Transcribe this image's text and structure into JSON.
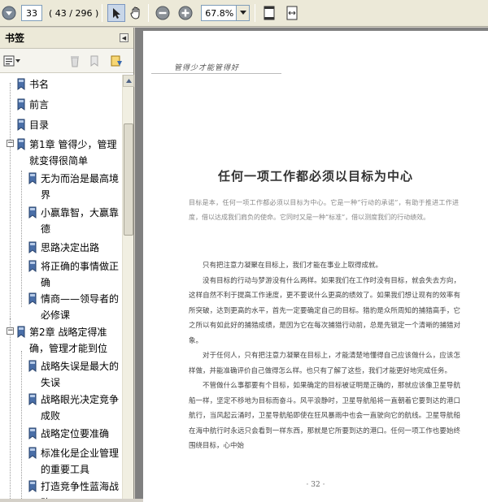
{
  "toolbar": {
    "page_current": "33",
    "page_count": "( 43 / 296 )",
    "zoom": "67.8%"
  },
  "sidebar": {
    "title": "书签",
    "items": [
      {
        "label": "书名",
        "level": 0
      },
      {
        "label": "前言",
        "level": 0
      },
      {
        "label": "目录",
        "level": 0
      },
      {
        "label": "第1章 管得少，管理就变得很简单",
        "level": 0,
        "expander": "−"
      },
      {
        "label": "无为而治是最高境界",
        "level": 1
      },
      {
        "label": "小赢靠智，大赢靠德",
        "level": 1
      },
      {
        "label": "思路决定出路",
        "level": 1
      },
      {
        "label": "将正确的事情做正确",
        "level": 1
      },
      {
        "label": "情商——领导者的必修课",
        "level": 1
      },
      {
        "label": "第2章 战略定得准确，管理才能到位",
        "level": 0,
        "expander": "−"
      },
      {
        "label": "战略失误是最大的失误",
        "level": 1
      },
      {
        "label": "战略眼光决定竞争成败",
        "level": 1
      },
      {
        "label": "战略定位要准确",
        "level": 1
      },
      {
        "label": "标准化是企业管理的重要工具",
        "level": 1
      },
      {
        "label": "打造竞争性蓝海战略",
        "level": 1
      }
    ]
  },
  "document": {
    "header": "管得少才能管得好",
    "title": "任何一项工作都必须以目标为中心",
    "intro": "目标是本，任何一项工作都必须以目标为中心。它是一种“行动的承诺”，有助于推进工作进度，借以达成我们肩负的使命。它同时又是一种“标准”，借以测度我们的行动绩效。",
    "paragraphs": [
      "只有把注意力凝聚在目标上，我们才能在事业上取得成就。",
      "没有目标的行动与梦游没有什么两样。如果我们在工作时没有目标，就会失去方向，这样自然不利于提高工作速度，更不要说什么更高的绩效了。如果我们想让现有的效率有所突破，达到更高的水平，首先一定要确定自己的目标。猎豹是众所周知的捕猎高手，它之所以有如此好的捕猎成绩，是因为它在每次捕猎行动前，总是先锁定一个清晰的捕猎对象。",
      "对于任何人，只有把注意力凝聚在目标上，才能清楚地懂得自己应该做什么，应该怎样做，并能准确评价自己做得怎么样。也只有了解了这些，我们才能更好地完成任务。",
      "不管做什么事都要有个目标，如果确定的目标被证明是正确的，那就应该像卫星导航船一样，坚定不移地为目标而奋斗。风平浪静时，卫星导航船将一直朝着它要到达的港口航行，当风起云涌时，卫星导航船即使在狂风暴雨中也会一直驶向它的航线。卫星导航船在海中航行时永远只会看到一样东西，那就是它所要到达的港口。任何一项工作也要始终围绕目标，心中始"
    ],
    "page_number": "· 32 ·"
  }
}
